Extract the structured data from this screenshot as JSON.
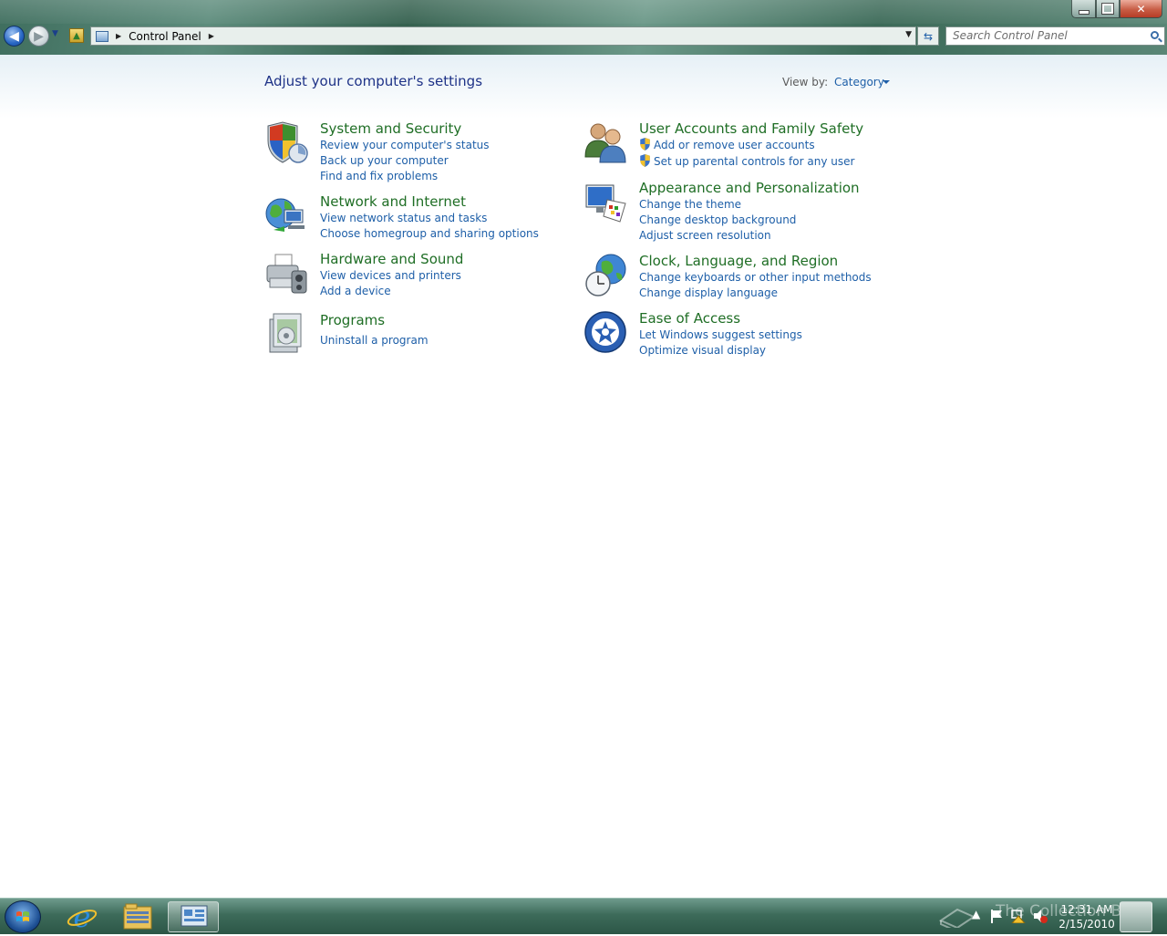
{
  "breadcrumb": {
    "segments": [
      "Control Panel"
    ]
  },
  "search": {
    "placeholder": "Search Control Panel"
  },
  "page": {
    "heading": "Adjust your computer's settings",
    "view_by_label": "View by:",
    "view_by_value": "Category"
  },
  "categories": {
    "system_security": {
      "title": "System and Security",
      "icon": "shield-icon",
      "links": [
        "Review your computer's status",
        "Back up your computer",
        "Find and fix problems"
      ]
    },
    "network_internet": {
      "title": "Network and Internet",
      "icon": "network-globe-icon",
      "links": [
        "View network status and tasks",
        "Choose homegroup and sharing options"
      ]
    },
    "hardware_sound": {
      "title": "Hardware and Sound",
      "icon": "printer-icon",
      "links": [
        "View devices and printers",
        "Add a device"
      ]
    },
    "programs": {
      "title": "Programs",
      "icon": "programs-box-icon",
      "links": [
        "Uninstall a program"
      ]
    },
    "user_accounts": {
      "title": "User Accounts and Family Safety",
      "icon": "users-icon",
      "links": [
        "Add or remove user accounts",
        "Set up parental controls for any user"
      ]
    },
    "appearance": {
      "title": "Appearance and Personalization",
      "icon": "monitor-palette-icon",
      "links": [
        "Change the theme",
        "Change desktop background",
        "Adjust screen resolution"
      ]
    },
    "clock_region": {
      "title": "Clock, Language, and Region",
      "icon": "clock-globe-icon",
      "links": [
        "Change keyboards or other input methods",
        "Change display language"
      ]
    },
    "ease_access": {
      "title": "Ease of Access",
      "icon": "ease-of-access-icon",
      "links": [
        "Let Windows suggest settings",
        "Optimize visual display"
      ]
    }
  },
  "taskbar": {
    "time": "12:31 AM",
    "date": "2/15/2010",
    "watermark": "The Collection Book"
  },
  "colors": {
    "category_title": "#1f6e25",
    "link": "#1e5fa8",
    "heading": "#1e3287"
  }
}
